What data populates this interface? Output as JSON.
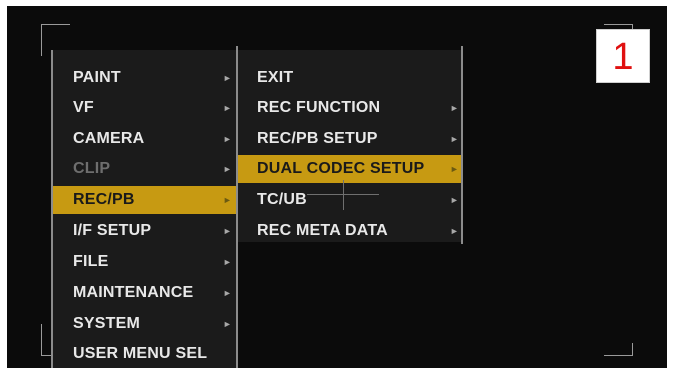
{
  "main_menu": {
    "items": [
      {
        "label": "PAINT",
        "arrow": "►"
      },
      {
        "label": "VF",
        "arrow": "►"
      },
      {
        "label": "CAMERA",
        "arrow": "►"
      },
      {
        "label": "CLIP",
        "arrow": "►"
      },
      {
        "label": "REC/PB",
        "arrow": "►"
      },
      {
        "label": "I/F SETUP",
        "arrow": "►"
      },
      {
        "label": "FILE",
        "arrow": "►"
      },
      {
        "label": "MAINTENANCE",
        "arrow": "►"
      },
      {
        "label": "SYSTEM",
        "arrow": "►"
      },
      {
        "label": "USER MENU SEL",
        "arrow": ""
      }
    ],
    "selected": "REC/PB",
    "disabled": "CLIP"
  },
  "sub_menu": {
    "items": [
      {
        "label": "EXIT",
        "arrow": ""
      },
      {
        "label": "REC FUNCTION",
        "arrow": "►"
      },
      {
        "label": "REC/PB SETUP",
        "arrow": "►"
      },
      {
        "label": "DUAL CODEC SETUP",
        "arrow": "►"
      },
      {
        "label": "TC/UB",
        "arrow": "►"
      },
      {
        "label": "REC META DATA",
        "arrow": "►"
      }
    ],
    "selected": "DUAL CODEC SETUP"
  },
  "badge": {
    "label": "1"
  },
  "colors": {
    "highlight": "#c79a12",
    "background": "#0b0b0b",
    "badge_text": "#e01010"
  }
}
